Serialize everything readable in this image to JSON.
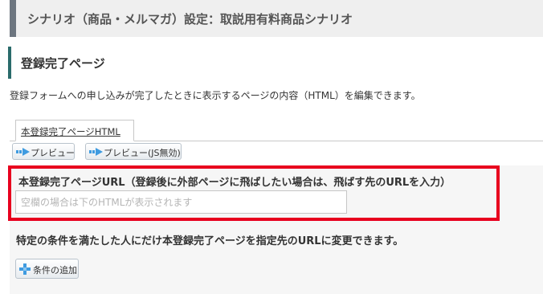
{
  "header": {
    "title": "シナリオ（商品・メルマガ）設定：取説用有料商品シナリオ"
  },
  "section": {
    "title": "登録完了ページ"
  },
  "description": "登録フォームへの申し込みが完了したときに表示するページの内容（HTML）を編集できます。",
  "tab": {
    "label": "本登録完了ページHTML"
  },
  "toolbar": {
    "preview_label": "プレビュー",
    "preview_nojs_label": "プレビュー(JS無効)"
  },
  "url_field": {
    "label": "本登録完了ページURL（登録後に外部ページに飛ばしたい場合は、飛ばす先のURLを入力）",
    "placeholder": "空欄の場合は下のHTMLが表示されます",
    "value": ""
  },
  "conditions": {
    "text": "特定の条件を満たした人にだけ本登録完了ページを指定先のURLに変更できます。",
    "add_label": "条件の追加"
  },
  "colors": {
    "highlight": "#e8001e",
    "accent": "#2a6b6b",
    "icon_blue": "#3f9be0"
  },
  "icons": {
    "preview": "arrow-right-icon",
    "add": "plus-icon"
  }
}
